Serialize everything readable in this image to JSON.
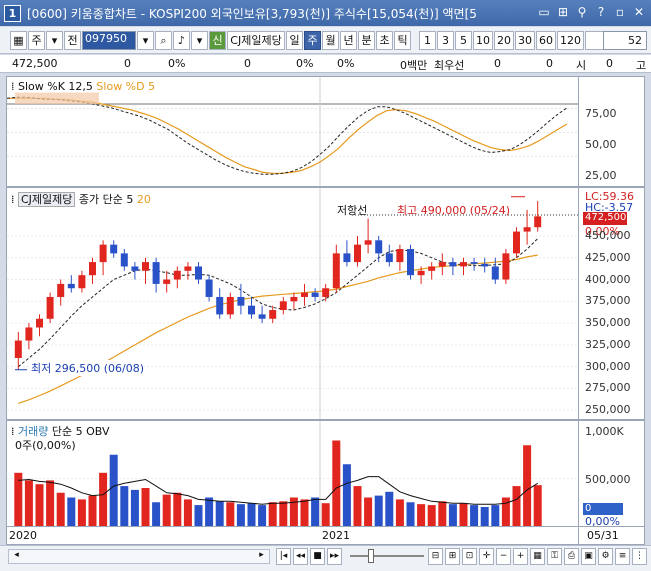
{
  "window": {
    "title": "[0600] 키움종합차트 - KOSPI200 외국인보유[3,793(천)] 주식수[15,054(천)] 액면[5",
    "app_icon": "1"
  },
  "title_icons": [
    "minimize-icon",
    "maximize-icon",
    "pin-icon",
    "help-icon",
    "restore-icon",
    "close-icon"
  ],
  "toolbar": {
    "stock_type": "주",
    "period_label": "전",
    "code": "097950",
    "toggle_label": "신",
    "stock_name": "CJ제일제당",
    "periods": [
      "일",
      "주",
      "월",
      "년",
      "분",
      "초",
      "틱"
    ],
    "selected_period": "주",
    "intervals": [
      "1",
      "3",
      "5",
      "10",
      "20",
      "30",
      "60",
      "120"
    ],
    "zoom": "52"
  },
  "inforow": {
    "price": "472,500",
    "v1": "0",
    "p1": "0%",
    "v2": "0",
    "p2": "0%",
    "p3": "0%",
    "v3": "0백만",
    "preferred": "최우선",
    "v4": "0",
    "v5": "0",
    "open_label": "시",
    "open": "0",
    "high_label": "고"
  },
  "stoch": {
    "title": "Slow %K 12,5",
    "title2": "Slow %D 5",
    "axis": [
      "75,00",
      "50,00",
      "25,00"
    ],
    "kvals": [
      86,
      87,
      87,
      86,
      85,
      85,
      84,
      83,
      82,
      80,
      78,
      76,
      73,
      70,
      67,
      63,
      58,
      53,
      46,
      39,
      33,
      27,
      21,
      16,
      12,
      9,
      7,
      6,
      6,
      7,
      9,
      13,
      19,
      27,
      36,
      47,
      57,
      66,
      73,
      77,
      77,
      74,
      70,
      65,
      60,
      55,
      50,
      45,
      40,
      35,
      31,
      29,
      30,
      32,
      37,
      44,
      52,
      61,
      69,
      76
    ],
    "dvals": [
      86,
      86,
      86,
      86,
      86,
      85,
      85,
      84,
      83,
      82,
      80,
      78,
      76,
      74,
      71,
      68,
      64,
      59,
      54,
      48,
      42,
      36,
      30,
      24,
      19,
      14,
      11,
      8,
      7,
      7,
      8,
      10,
      14,
      19,
      26,
      34,
      44,
      53,
      61,
      68,
      73,
      74,
      73,
      70,
      66,
      62,
      57,
      52,
      47,
      42,
      38,
      34,
      32,
      31,
      33,
      36,
      41,
      47,
      53,
      59
    ]
  },
  "price": {
    "name": "CJ제일제당",
    "ma_label": "종가 단순 5",
    "ma_value": "20",
    "resistance": "저항선",
    "high_note": "최고 490,000 (05/24)",
    "low_note": "최저 296,500 (06/08)",
    "lc": "LC:59.36",
    "hc": "HC:-3.57",
    "current": "472,500",
    "current_pct": "0.00%",
    "axis": [
      "450,000",
      "425,000",
      "400,000",
      "375,000",
      "350,000",
      "325,000",
      "300,000",
      "275,000",
      "250,000"
    ],
    "year_2020": "2020",
    "year_2021": "2021",
    "candles": [
      [
        310,
        340,
        296.5,
        330
      ],
      [
        330,
        350,
        320,
        345
      ],
      [
        345,
        360,
        335,
        355
      ],
      [
        355,
        385,
        350,
        380
      ],
      [
        380,
        400,
        370,
        395
      ],
      [
        395,
        405,
        385,
        390
      ],
      [
        390,
        410,
        385,
        405
      ],
      [
        405,
        425,
        395,
        420
      ],
      [
        420,
        445,
        405,
        440
      ],
      [
        440,
        445,
        425,
        430
      ],
      [
        430,
        435,
        410,
        415
      ],
      [
        415,
        420,
        400,
        410
      ],
      [
        410,
        425,
        395,
        420
      ],
      [
        420,
        425,
        385,
        395
      ],
      [
        395,
        410,
        385,
        400
      ],
      [
        400,
        415,
        390,
        410
      ],
      [
        410,
        420,
        400,
        415
      ],
      [
        415,
        420,
        395,
        400
      ],
      [
        400,
        405,
        375,
        380
      ],
      [
        380,
        390,
        355,
        360
      ],
      [
        360,
        385,
        355,
        380
      ],
      [
        380,
        395,
        360,
        370
      ],
      [
        370,
        380,
        355,
        360
      ],
      [
        360,
        370,
        350,
        355
      ],
      [
        355,
        370,
        350,
        365
      ],
      [
        365,
        380,
        360,
        375
      ],
      [
        375,
        385,
        365,
        380
      ],
      [
        380,
        395,
        370,
        385
      ],
      [
        385,
        390,
        375,
        380
      ],
      [
        380,
        395,
        375,
        390
      ],
      [
        390,
        440,
        385,
        430
      ],
      [
        430,
        445,
        415,
        420
      ],
      [
        420,
        450,
        415,
        440
      ],
      [
        440,
        470,
        430,
        445
      ],
      [
        445,
        450,
        420,
        430
      ],
      [
        430,
        440,
        415,
        420
      ],
      [
        420,
        440,
        410,
        435
      ],
      [
        435,
        440,
        400,
        405
      ],
      [
        405,
        415,
        395,
        410
      ],
      [
        410,
        420,
        400,
        415
      ],
      [
        415,
        430,
        405,
        420
      ],
      [
        420,
        425,
        405,
        415
      ],
      [
        415,
        425,
        405,
        420
      ],
      [
        420,
        425,
        410,
        418
      ],
      [
        418,
        425,
        408,
        415
      ],
      [
        415,
        425,
        395,
        400
      ],
      [
        400,
        435,
        395,
        430
      ],
      [
        430,
        460,
        425,
        455
      ],
      [
        455,
        480,
        440,
        460
      ],
      [
        460,
        490,
        455,
        472.5
      ]
    ],
    "ma5": [
      300,
      310,
      320,
      332,
      345,
      358,
      370,
      380,
      390,
      400,
      405,
      410,
      412,
      410,
      408,
      405,
      405,
      406,
      405,
      400,
      395,
      388,
      380,
      372,
      368,
      366,
      365,
      368,
      372,
      378,
      385,
      395,
      405,
      415,
      425,
      432,
      434,
      433,
      430,
      425,
      420,
      418,
      417,
      416,
      416,
      417,
      418,
      425,
      435,
      447
    ],
    "ma20": [
      258,
      262,
      267,
      272,
      278,
      284,
      290,
      297,
      304,
      311,
      318,
      325,
      332,
      339,
      345,
      351,
      357,
      362,
      367,
      371,
      374,
      377,
      379,
      381,
      382,
      383,
      384,
      385,
      386,
      387,
      389,
      392,
      395,
      398,
      402,
      405,
      408,
      410,
      412,
      414,
      415,
      416,
      417,
      418,
      419,
      420,
      421,
      423,
      426,
      428
    ]
  },
  "volume": {
    "title": "거래량",
    "ma_label": "단순 5",
    "obv": "OBV",
    "zero": "0주(0,00%)",
    "axis": [
      "1,000K",
      "500,000",
      "0",
      "0,00%"
    ],
    "date": "05/31",
    "bars": [
      560,
      480,
      440,
      480,
      350,
      300,
      280,
      320,
      560,
      750,
      420,
      380,
      400,
      250,
      330,
      350,
      280,
      220,
      300,
      260,
      250,
      230,
      240,
      220,
      250,
      260,
      300,
      280,
      300,
      240,
      900,
      650,
      420,
      300,
      320,
      360,
      280,
      250,
      230,
      220,
      260,
      230,
      240,
      220,
      200,
      220,
      300,
      420,
      850,
      430
    ],
    "ma": [
      480,
      490,
      470,
      460,
      440,
      400,
      350,
      320,
      330,
      420,
      450,
      470,
      490,
      420,
      350,
      340,
      320,
      280,
      270,
      260,
      260,
      250,
      240,
      230,
      240,
      240,
      250,
      260,
      280,
      280,
      400,
      450,
      480,
      520,
      520,
      440,
      360,
      320,
      290,
      260,
      250,
      240,
      240,
      230,
      230,
      230,
      240,
      280,
      380,
      450
    ]
  }
}
